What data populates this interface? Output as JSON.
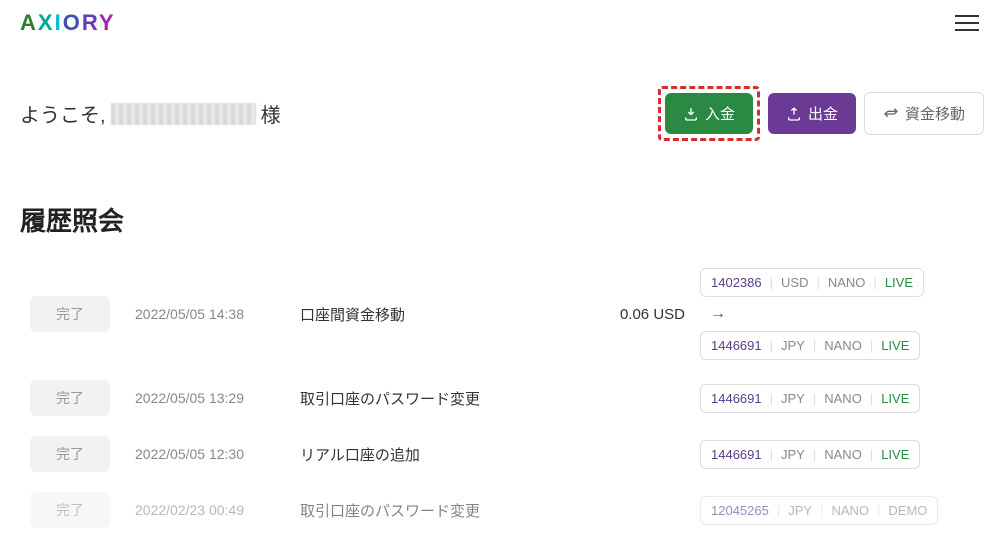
{
  "logo_text": "AXIORY",
  "welcome": {
    "prefix": "ようこそ,",
    "suffix": "様"
  },
  "actions": {
    "deposit": "入金",
    "withdraw": "出金",
    "transfer": "資金移動"
  },
  "section_title": "履歴照会",
  "history": [
    {
      "status": "完了",
      "datetime": "2022/05/05 14:38",
      "desc": "口座間資金移動",
      "amount": "0.06 USD",
      "accounts": [
        {
          "num": "1402386",
          "currency": "USD",
          "plan": "NANO",
          "mode": "LIVE"
        },
        {
          "num": "1446691",
          "currency": "JPY",
          "plan": "NANO",
          "mode": "LIVE"
        }
      ],
      "has_arrow": true
    },
    {
      "status": "完了",
      "datetime": "2022/05/05 13:29",
      "desc": "取引口座のパスワード変更",
      "amount": "",
      "accounts": [
        {
          "num": "1446691",
          "currency": "JPY",
          "plan": "NANO",
          "mode": "LIVE"
        }
      ]
    },
    {
      "status": "完了",
      "datetime": "2022/05/05 12:30",
      "desc": "リアル口座の追加",
      "amount": "",
      "accounts": [
        {
          "num": "1446691",
          "currency": "JPY",
          "plan": "NANO",
          "mode": "LIVE"
        }
      ]
    },
    {
      "status": "完了",
      "datetime": "2022/02/23 00:49",
      "desc": "取引口座のパスワード変更",
      "amount": "",
      "accounts": [
        {
          "num": "12045265",
          "currency": "JPY",
          "plan": "NANO",
          "mode": "DEMO"
        }
      ],
      "partial": true
    }
  ]
}
